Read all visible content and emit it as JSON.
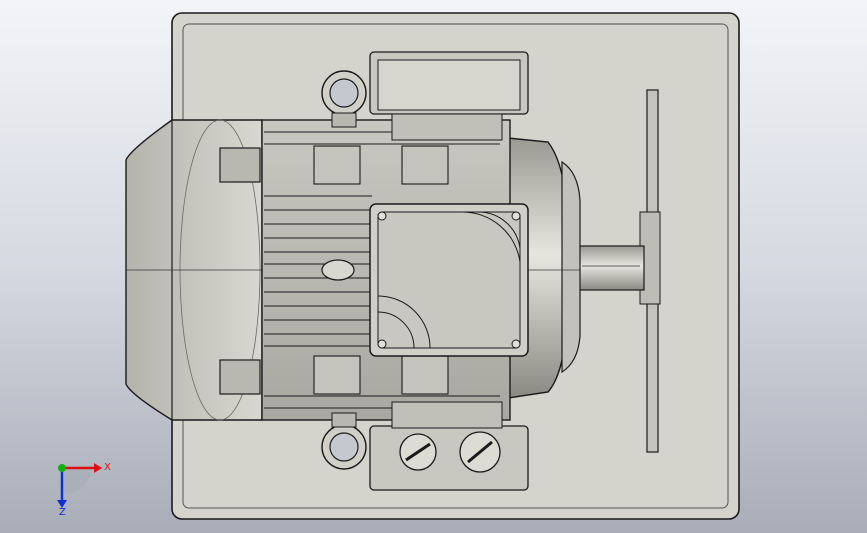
{
  "triad": {
    "x_label": "X",
    "z_label": "Z",
    "colors": {
      "x": "#e01010",
      "y": "#10b010",
      "z": "#1030d0"
    }
  },
  "colors": {
    "background_top": "#f3f4f8",
    "background_bottom": "#a9adb8",
    "part_fill": "#d4d4cc",
    "edge": "#1a1a1a"
  }
}
